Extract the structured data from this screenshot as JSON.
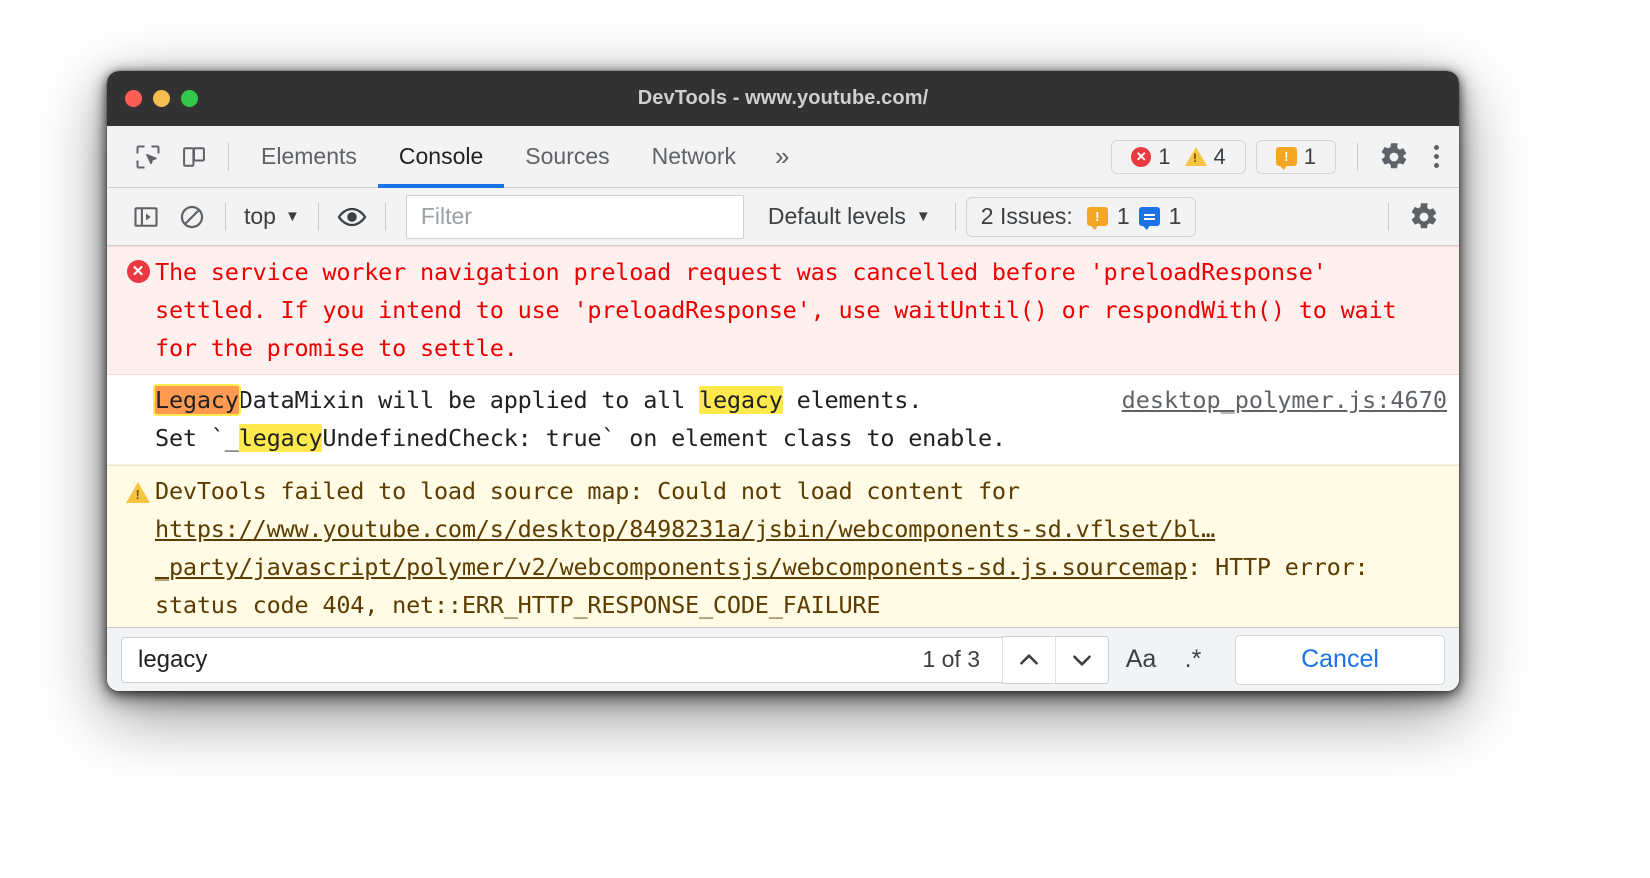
{
  "window": {
    "title": "DevTools - www.youtube.com/",
    "traffic_lights": [
      "close",
      "minimize",
      "zoom"
    ],
    "colors": {
      "titlebar_bg": "#323232",
      "accent": "#1a73e8",
      "error_red": "#eb3941",
      "warn_yellow": "#f5c443",
      "issue_orange": "#f5a623",
      "highlight_yellow": "#ffe94d",
      "highlight_active_orange": "#ff9a52"
    }
  },
  "tabbar": {
    "inspect_icon": "inspect-cursor-icon",
    "device_icon": "device-toolbar-icon",
    "tabs": [
      {
        "label": "Elements",
        "active": false
      },
      {
        "label": "Console",
        "active": true
      },
      {
        "label": "Sources",
        "active": false
      },
      {
        "label": "Network",
        "active": false
      }
    ],
    "more_tabs_label": "»",
    "counters": {
      "errors": "1",
      "warnings": "4",
      "issues": "1"
    },
    "settings_icon": "gear-icon",
    "menu_icon": "kebab-menu-icon"
  },
  "console_toolbar": {
    "sidebar_icon": "console-sidebar-icon",
    "clear_icon": "clear-console-icon",
    "context_selector": "top",
    "context_caret": "▼",
    "eye_icon": "live-expression-eye-icon",
    "filter_placeholder": "Filter",
    "filter_value": "",
    "levels_label": "Default levels",
    "levels_caret": "▼",
    "issues_label": "2 Issues:",
    "issues_count_warning": "1",
    "issues_count_info": "1",
    "settings_icon": "gear-icon"
  },
  "messages": [
    {
      "type": "error",
      "icon": "error-circle-icon",
      "text": "The service worker navigation preload request was cancelled before 'preloadResponse' settled. If you intend to use 'preloadResponse', use waitUntil() or respondWith() to wait for the promise to settle.",
      "source": ""
    },
    {
      "type": "log",
      "icon": "",
      "segments": [
        {
          "t": "Legacy",
          "hl": "active"
        },
        {
          "t": "DataMixin will be applied to all ",
          "hl": "none"
        },
        {
          "t": "legacy",
          "hl": "match"
        },
        {
          "t": " elements.\nSet `_",
          "hl": "none"
        },
        {
          "t": "legacy",
          "hl": "match"
        },
        {
          "t": "UndefinedCheck: true` on element class to enable.",
          "hl": "none"
        }
      ],
      "source": "desktop_polymer.js:4670"
    },
    {
      "type": "warning",
      "icon": "warning-triangle-icon",
      "prefix": "DevTools failed to load source map: Could not load content for ",
      "link": "https://www.youtube.com/s/desktop/8498231a/jsbin/webcomponents-sd.vflset/bl…_party/javascript/polymer/v2/webcomponentsjs/webcomponents-sd.js.sourcemap",
      "suffix": ": HTTP error: status code 404, net::ERR_HTTP_RESPONSE_CODE_FAILURE",
      "source": ""
    }
  ],
  "findbar": {
    "query": "legacy",
    "match_count": "1 of 3",
    "prev_icon": "chevron-up-icon",
    "next_icon": "chevron-down-icon",
    "match_case_label": "Aa",
    "regex_label": ".*",
    "cancel_label": "Cancel"
  }
}
